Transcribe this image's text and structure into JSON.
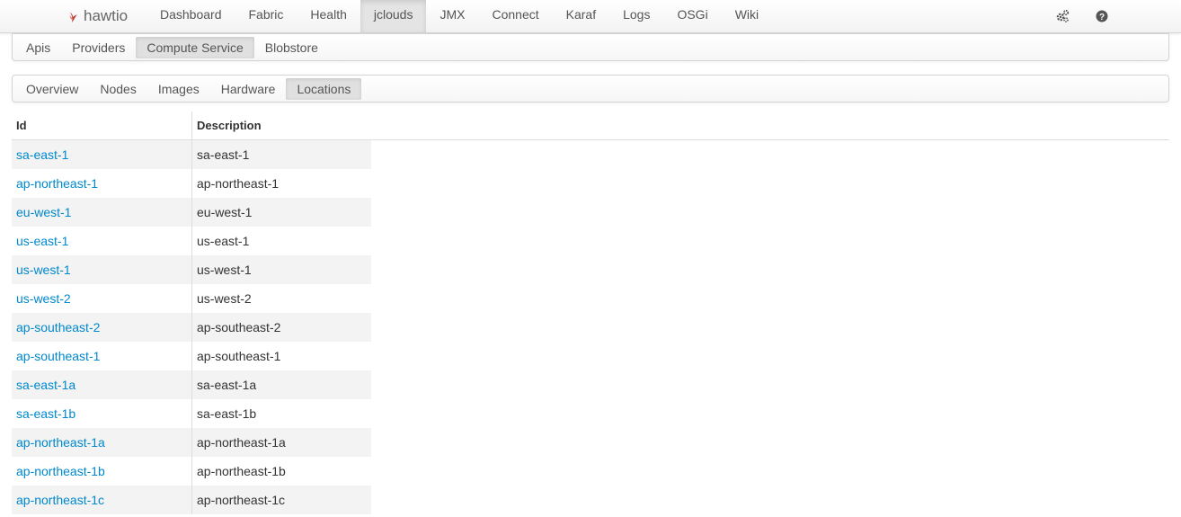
{
  "brand": {
    "name": "hawtio",
    "logo_color": "#c0392b"
  },
  "nav": {
    "items": [
      "Dashboard",
      "Fabric",
      "Health",
      "jclouds",
      "JMX",
      "Connect",
      "Karaf",
      "Logs",
      "OSGi",
      "Wiki"
    ],
    "active": "jclouds",
    "right_icons": [
      "gears-icon",
      "help-icon"
    ]
  },
  "subnav": {
    "items": [
      "Apis",
      "Providers",
      "Compute Service",
      "Blobstore"
    ],
    "active": "Compute Service"
  },
  "compute_tabs": {
    "items": [
      "Overview",
      "Nodes",
      "Images",
      "Hardware",
      "Locations"
    ],
    "active": "Locations"
  },
  "table": {
    "headers": {
      "id": "Id",
      "description": "Description"
    },
    "rows": [
      {
        "id": "sa-east-1",
        "description": "sa-east-1"
      },
      {
        "id": "ap-northeast-1",
        "description": "ap-northeast-1"
      },
      {
        "id": "eu-west-1",
        "description": "eu-west-1"
      },
      {
        "id": "us-east-1",
        "description": "us-east-1"
      },
      {
        "id": "us-west-1",
        "description": "us-west-1"
      },
      {
        "id": "us-west-2",
        "description": "us-west-2"
      },
      {
        "id": "ap-southeast-2",
        "description": "ap-southeast-2"
      },
      {
        "id": "ap-southeast-1",
        "description": "ap-southeast-1"
      },
      {
        "id": "sa-east-1a",
        "description": "sa-east-1a"
      },
      {
        "id": "sa-east-1b",
        "description": "sa-east-1b"
      },
      {
        "id": "ap-northeast-1a",
        "description": "ap-northeast-1a"
      },
      {
        "id": "ap-northeast-1b",
        "description": "ap-northeast-1b"
      },
      {
        "id": "ap-northeast-1c",
        "description": "ap-northeast-1c"
      }
    ]
  },
  "colors": {
    "link": "#0088cc",
    "stripe": "#f3f3f3",
    "active_tab": "#e0e0e0"
  }
}
